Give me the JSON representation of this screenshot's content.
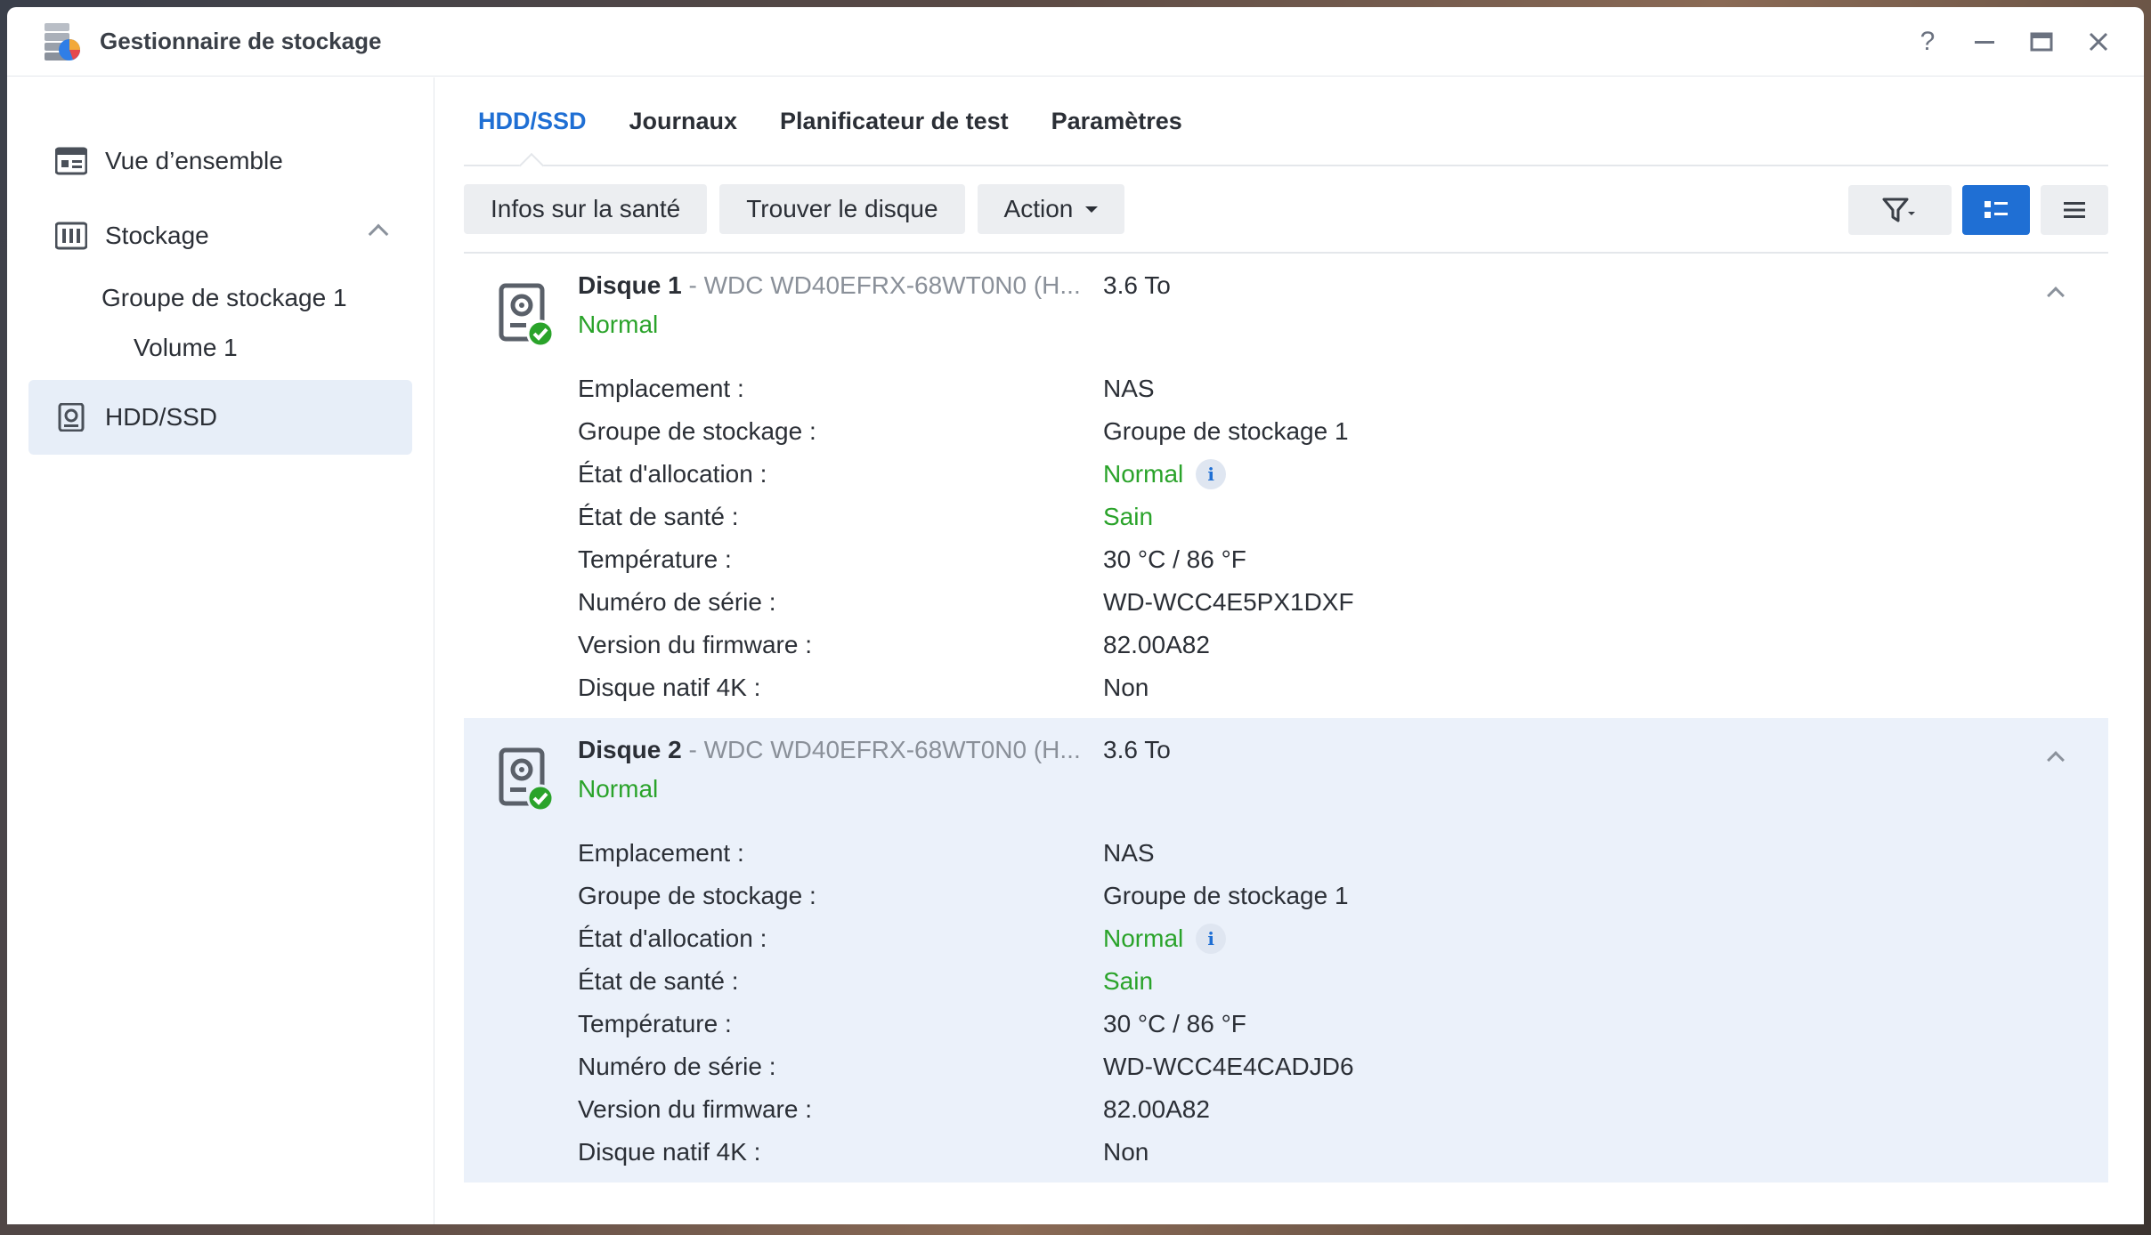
{
  "window": {
    "title": "Gestionnaire de stockage"
  },
  "window_controls": {
    "help": "?"
  },
  "sidebar": {
    "items": [
      {
        "label": "Vue d’ensemble"
      },
      {
        "label": "Stockage"
      },
      {
        "label": "Groupe de stockage 1"
      },
      {
        "label": "Volume 1"
      },
      {
        "label": "HDD/SSD"
      }
    ]
  },
  "tabs": [
    {
      "label": "HDD/SSD"
    },
    {
      "label": "Journaux"
    },
    {
      "label": "Planificateur de test"
    },
    {
      "label": "Paramètres"
    }
  ],
  "toolbar": {
    "health_label": "Infos sur la santé",
    "locate_label": "Trouver le disque",
    "action_label": "Action"
  },
  "labels": {
    "location": "Emplacement :",
    "pool": "Groupe de stockage :",
    "allocation": "État d'allocation :",
    "health": "État de santé :",
    "temperature": "Température :",
    "serial": "Numéro de série :",
    "firmware": "Version du firmware :",
    "native4k": "Disque natif 4K :"
  },
  "disks": [
    {
      "name": "Disque 1",
      "model": " - WDC WD40EFRX-68WT0N0 (H...",
      "size": "3.6 To",
      "status": "Normal",
      "location": "NAS",
      "pool": "Groupe de stockage 1",
      "allocation": "Normal",
      "health": "Sain",
      "temperature": "30 °C / 86 °F",
      "serial": "WD-WCC4E5PX1DXF",
      "firmware": "82.00A82",
      "native4k": "Non"
    },
    {
      "name": "Disque 2",
      "model": " - WDC WD40EFRX-68WT0N0 (H...",
      "size": "3.6 To",
      "status": "Normal",
      "location": "NAS",
      "pool": "Groupe de stockage 1",
      "allocation": "Normal",
      "health": "Sain",
      "temperature": "30 °C / 86 °F",
      "serial": "WD-WCC4E4CADJD6",
      "firmware": "82.00A82",
      "native4k": "Non"
    }
  ],
  "info_glyph": "i",
  "colors": {
    "accent": "#1f6fd4",
    "ok": "#2aa32a",
    "selected_bg": "#e7eef8"
  }
}
